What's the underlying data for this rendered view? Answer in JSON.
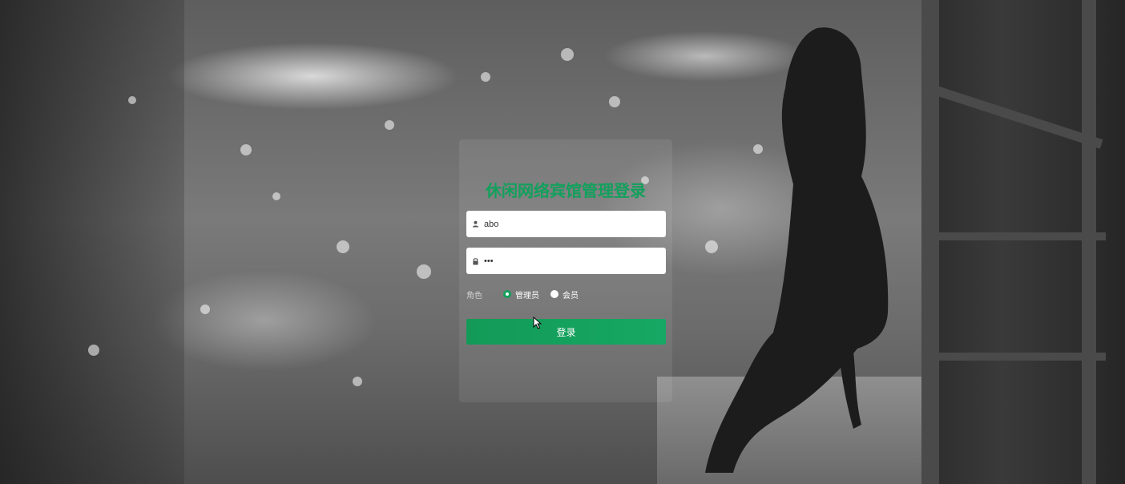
{
  "login": {
    "title": "休闲网络宾馆管理登录",
    "username_value": "abo",
    "password_value": "•••",
    "role_label": "角色",
    "role_options": [
      {
        "label": "管理员",
        "selected": true
      },
      {
        "label": "会员",
        "selected": false
      }
    ],
    "submit_label": "登录"
  },
  "icons": {
    "username": "user-icon",
    "password": "lock-icon"
  },
  "colors": {
    "accent": "#12a05c",
    "panel_bg": "rgba(255,255,255,0.08)"
  }
}
